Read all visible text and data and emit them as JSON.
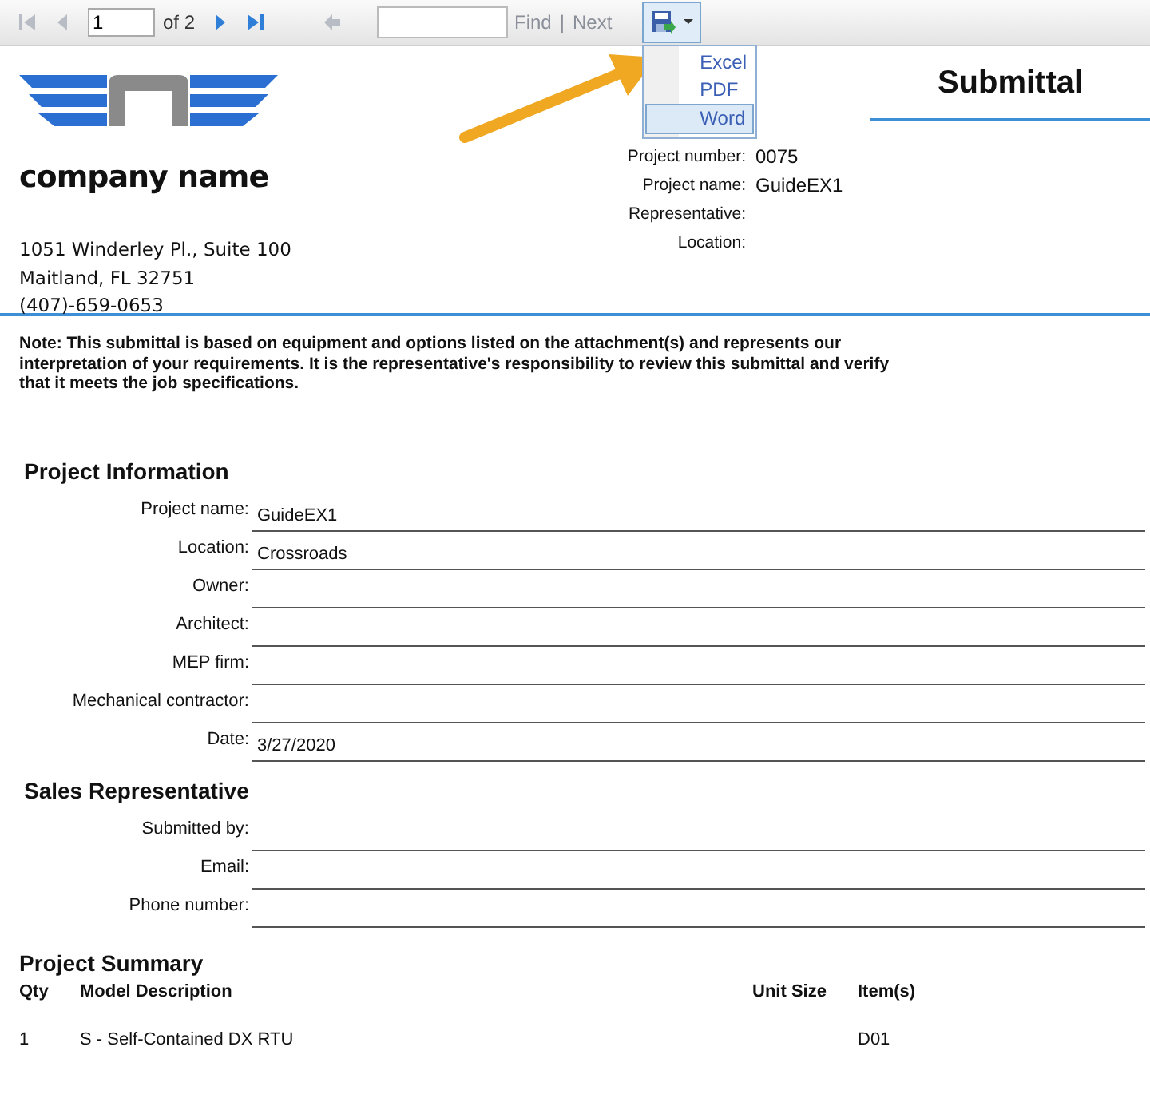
{
  "toolbar": {
    "page": "1",
    "page_count": "of 2",
    "find_label": "Find",
    "separator": "|",
    "next_label": "Next"
  },
  "export_menu": {
    "items": [
      {
        "label": "Excel",
        "selected": false
      },
      {
        "label": "PDF",
        "selected": false
      },
      {
        "label": "Word",
        "selected": true
      }
    ]
  },
  "header": {
    "company_name": "company name",
    "address_lines": [
      "1051 Winderley Pl., Suite 100",
      "Maitland, FL 32751",
      "(407)-659-0653"
    ],
    "title": "Submittal",
    "fields": [
      {
        "label": "Project number:",
        "value": "0075"
      },
      {
        "label": "Project name:",
        "value": "GuideEX1"
      },
      {
        "label": "Representative:"
      },
      {
        "label": "Location:"
      }
    ]
  },
  "note": "Note: This submittal is based on equipment and options listed on the attachment(s) and represents our interpretation of your requirements. It is the representative's responsibility to review this submittal and verify that it meets the job specifications.",
  "sections": [
    {
      "title": "Project Information",
      "fields": [
        {
          "label": "Project name:",
          "value": "GuideEX1"
        },
        {
          "label": "Location:",
          "value": "Crossroads"
        },
        {
          "label": "Owner:"
        },
        {
          "label": "Architect:"
        },
        {
          "label": "MEP firm:"
        },
        {
          "label": "Mechanical contractor:"
        },
        {
          "label": "Date:",
          "value": "3/27/2020"
        }
      ]
    },
    {
      "title": "Sales Representative",
      "fields": [
        {
          "label": "Submitted by:"
        },
        {
          "label": "Email:"
        },
        {
          "label": "Phone number:"
        }
      ]
    }
  ],
  "summary": {
    "title": "Project Summary",
    "columns": [
      "Qty",
      "Model Description",
      "Unit Size",
      "Item(s)"
    ],
    "rows": [
      {
        "qty": "1",
        "description": "S - Self-Contained DX RTU",
        "item": "D01"
      }
    ]
  }
}
